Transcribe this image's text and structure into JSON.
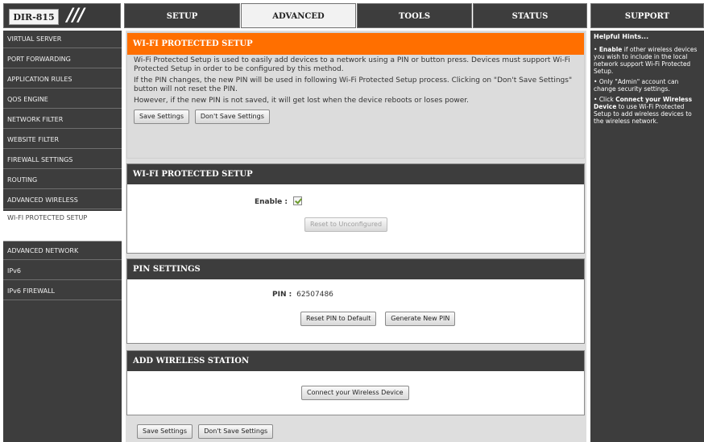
{
  "header": {
    "model": "DIR-815",
    "tabs": [
      "SETUP",
      "ADVANCED",
      "TOOLS",
      "STATUS",
      "SUPPORT"
    ],
    "active_tab": "ADVANCED"
  },
  "sidebar": {
    "items": [
      "VIRTUAL SERVER",
      "PORT FORWARDING",
      "APPLICATION RULES",
      "QOS ENGINE",
      "NETWORK FILTER",
      "WEBSITE FILTER",
      "FIREWALL SETTINGS",
      "ROUTING",
      "ADVANCED WIRELESS",
      "WI-FI PROTECTED SETUP",
      "ADVANCED NETWORK",
      "IPv6",
      "IPv6 FIREWALL"
    ],
    "active_item": "WI-FI PROTECTED SETUP"
  },
  "intro": {
    "title": "WI-FI PROTECTED SETUP",
    "para1": "Wi-Fi Protected Setup is used to easily add devices to a network using a PIN or button press. Devices must support Wi-Fi Protected Setup in order to be configured by this method.",
    "para2": "If the PIN changes, the new PIN will be used in following Wi-Fi Protected Setup process. Clicking on \"Don't Save Settings\" button will not reset the PIN.",
    "para3": "However, if the new PIN is not saved, it will get lost when the device reboots or loses power.",
    "save_label": "Save Settings",
    "dont_save_label": "Don't Save Settings"
  },
  "wps": {
    "title": "WI-FI PROTECTED SETUP",
    "enable_label": "Enable :",
    "enable_checked": true,
    "reset_label": "Reset to Unconfigured"
  },
  "pin": {
    "title": "PIN SETTINGS",
    "pin_label": "PIN :",
    "pin_value": "62507486",
    "reset_pin_label": "Reset PIN to Default",
    "generate_label": "Generate New PIN"
  },
  "station": {
    "title": "ADD WIRELESS STATION",
    "connect_label": "Connect your Wireless Device"
  },
  "bottom": {
    "save_label": "Save Settings",
    "dont_save_label": "Don't Save Settings"
  },
  "help": {
    "title": "Helpful Hints...",
    "hint1_bold": "Enable",
    "hint1_text": " if other wireless devices you wish to include in the local network support Wi-Fi Protected Setup.",
    "hint2_text": "Only \"Admin\" account can change security settings.",
    "hint3_prefix": "Click ",
    "hint3_bold": "Connect your Wireless Device",
    "hint3_text": " to use Wi-Fi Protected Setup to add wireless devices to the wireless network."
  }
}
